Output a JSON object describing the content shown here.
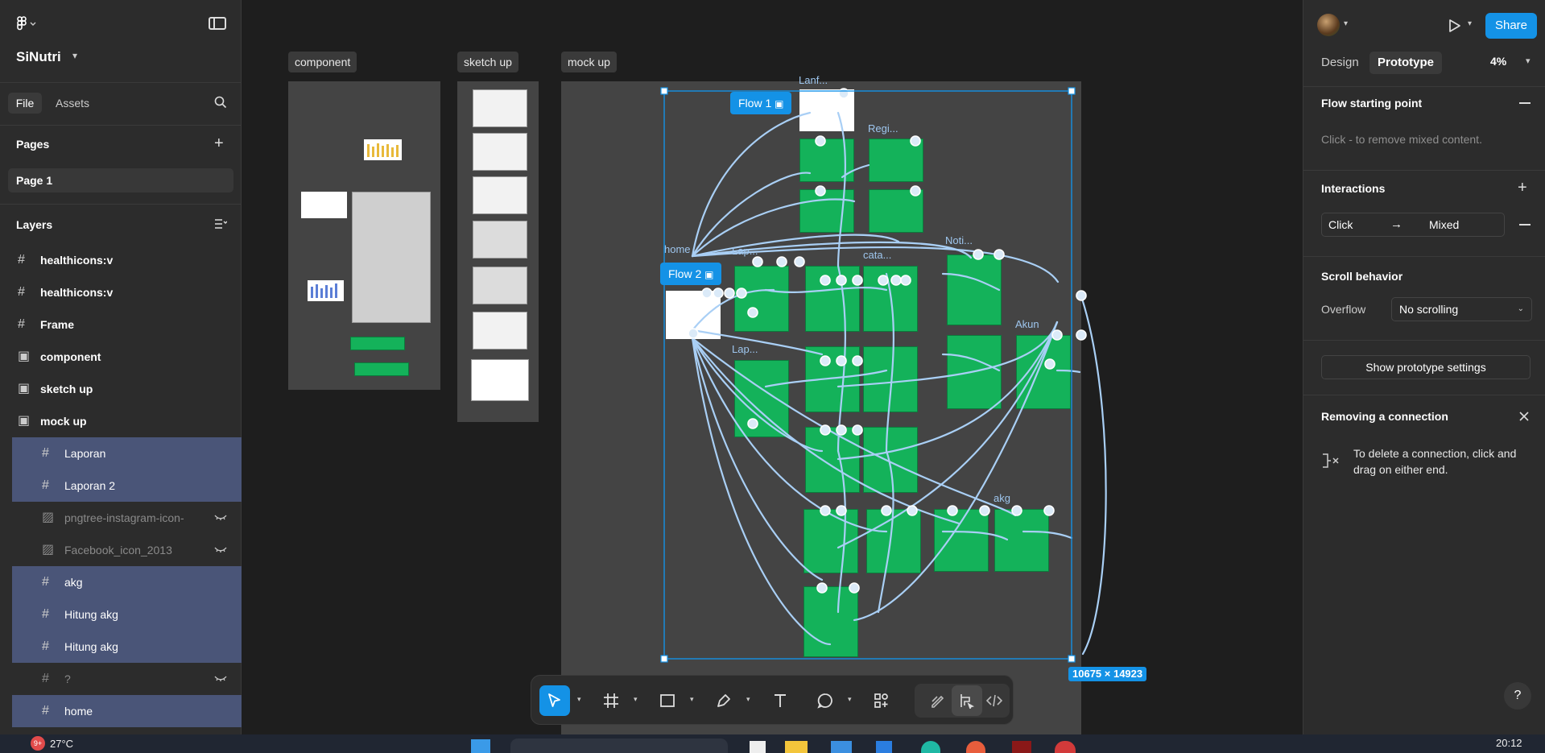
{
  "app": {
    "project_name": "SiNutri",
    "logo_icon": "figma-menu-icon"
  },
  "left_panel": {
    "tabs": {
      "file": "File",
      "assets": "Assets"
    },
    "pages_title": "Pages",
    "pages": [
      "Page 1"
    ],
    "layers_title": "Layers",
    "layers": [
      {
        "label": "healthicons:v",
        "icon": "frame-icon",
        "level": 0,
        "selected": false,
        "hidden": false
      },
      {
        "label": "healthicons:v",
        "icon": "frame-icon",
        "level": 0,
        "selected": false,
        "hidden": false
      },
      {
        "label": "Frame",
        "icon": "frame-icon",
        "level": 0,
        "selected": false,
        "hidden": false
      },
      {
        "label": "component",
        "icon": "section-icon",
        "level": 0,
        "selected": false,
        "hidden": false
      },
      {
        "label": "sketch up",
        "icon": "section-icon",
        "level": 0,
        "selected": false,
        "hidden": false
      },
      {
        "label": "mock up",
        "icon": "section-icon",
        "level": 0,
        "selected": false,
        "hidden": false
      },
      {
        "label": "Laporan",
        "icon": "frame-icon",
        "level": 1,
        "selected": true,
        "hidden": false
      },
      {
        "label": "Laporan 2",
        "icon": "frame-icon",
        "level": 1,
        "selected": true,
        "hidden": false
      },
      {
        "label": "pngtree-instagram-icon-",
        "icon": "image-icon",
        "level": 1,
        "selected": false,
        "hidden": true
      },
      {
        "label": "Facebook_icon_2013",
        "icon": "image-icon",
        "level": 1,
        "selected": false,
        "hidden": true
      },
      {
        "label": "akg",
        "icon": "frame-icon",
        "level": 1,
        "selected": true,
        "hidden": false
      },
      {
        "label": "Hitung akg",
        "icon": "frame-icon",
        "level": 1,
        "selected": true,
        "hidden": false
      },
      {
        "label": "Hitung akg",
        "icon": "frame-icon",
        "level": 1,
        "selected": true,
        "hidden": false
      },
      {
        "label": "?",
        "icon": "frame-icon",
        "level": 1,
        "selected": false,
        "hidden": true
      },
      {
        "label": "home",
        "icon": "frame-icon",
        "level": 1,
        "selected": true,
        "hidden": false
      }
    ]
  },
  "canvas": {
    "section_tags": {
      "component": "component",
      "sketch": "sketch up",
      "mockup": "mock up"
    },
    "flow_tags": {
      "flow1": "Flow 1",
      "flow2": "Flow 2"
    },
    "frame_labels": {
      "landing": "Lanf...",
      "register": "Regi...",
      "home": "home",
      "laporan": "Lap...",
      "laporan2": "Lap...",
      "catatan": "cata...",
      "notifikasi": "Noti...",
      "akun": "Akun",
      "akg": "akg"
    },
    "selection_size": "10675 × 14923"
  },
  "toolbar": {
    "tools": [
      "move-tool",
      "frame-tool",
      "rectangle-tool",
      "pen-tool",
      "text-tool",
      "comment-tool",
      "actions-tool"
    ],
    "modes": [
      "draw-mode",
      "design-mode",
      "dev-mode"
    ]
  },
  "right_panel": {
    "share_label": "Share",
    "tabs": {
      "design": "Design",
      "prototype": "Prototype"
    },
    "zoom": "4%",
    "flow_starting_point": {
      "title": "Flow starting point",
      "hint": "Click - to remove mixed content."
    },
    "interactions": {
      "title": "Interactions",
      "trigger": "Click",
      "action": "Mixed"
    },
    "scroll": {
      "title": "Scroll behavior",
      "overflow_label": "Overflow",
      "overflow_value": "No scrolling"
    },
    "prototype_settings_label": "Show prototype settings",
    "removing_connection": {
      "title": "Removing a connection",
      "text": "To delete a connection, click and drag on either end."
    },
    "help_label": "?"
  },
  "taskbar": {
    "notification_badge": "9+",
    "weather": "27°C",
    "clock": "20:12"
  },
  "colors": {
    "accent": "#1492e6",
    "selection": "#4a5578",
    "screen_green": "#14b25a",
    "connector": "#a9cff5"
  }
}
